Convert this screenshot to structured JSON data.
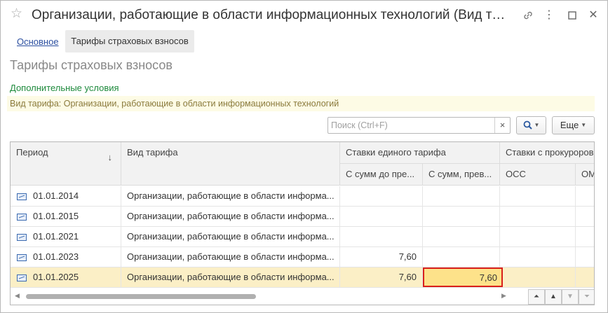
{
  "window": {
    "title": "Организации, работающие в области информационных технологий (Вид тарифа ...",
    "link_icon": "link-icon",
    "more_icon": "more-vertical-icon",
    "maximize_icon": "maximize-icon",
    "close_icon": "close-icon"
  },
  "tabs": [
    {
      "label": "Основное",
      "active": false
    },
    {
      "label": "Тарифы страховых взносов",
      "active": true
    }
  ],
  "page_title": "Тарифы страховых взносов",
  "extra_conditions_label": "Дополнительные условия",
  "tariff_type_text": "Вид тарифа: Организации, работающие в области информационных технологий",
  "search": {
    "placeholder": "Поиск (Ctrl+F)",
    "value": "",
    "clear": "×"
  },
  "toolbar": {
    "more_label": "Еще"
  },
  "table": {
    "headers": {
      "period": "Период",
      "type": "Вид тарифа",
      "single_group": "Ставки единого тарифа",
      "single_below": "С сумм до пре...",
      "single_above": "С сумм, прев...",
      "prosecutor_group": "Ставки с прокуроров",
      "oss": "ОСС",
      "om": "ОМ"
    },
    "rows": [
      {
        "period": "01.01.2014",
        "type": "Организации, работающие в области информа...",
        "below": "",
        "above": ""
      },
      {
        "period": "01.01.2015",
        "type": "Организации, работающие в области информа...",
        "below": "",
        "above": ""
      },
      {
        "period": "01.01.2021",
        "type": "Организации, работающие в области информа...",
        "below": "",
        "above": ""
      },
      {
        "period": "01.01.2023",
        "type": "Организации, работающие в области информа...",
        "below": "7,60",
        "above": ""
      },
      {
        "period": "01.01.2025",
        "type": "Организации, работающие в области информа...",
        "below": "7,60",
        "above": "7,60",
        "selected": true
      }
    ]
  },
  "colors": {
    "selected_row": "#fbefc6",
    "highlight_cell": "#fde28a",
    "highlight_border": "#d9201b",
    "link": "#2c4fa0",
    "green": "#1e8a3c"
  }
}
